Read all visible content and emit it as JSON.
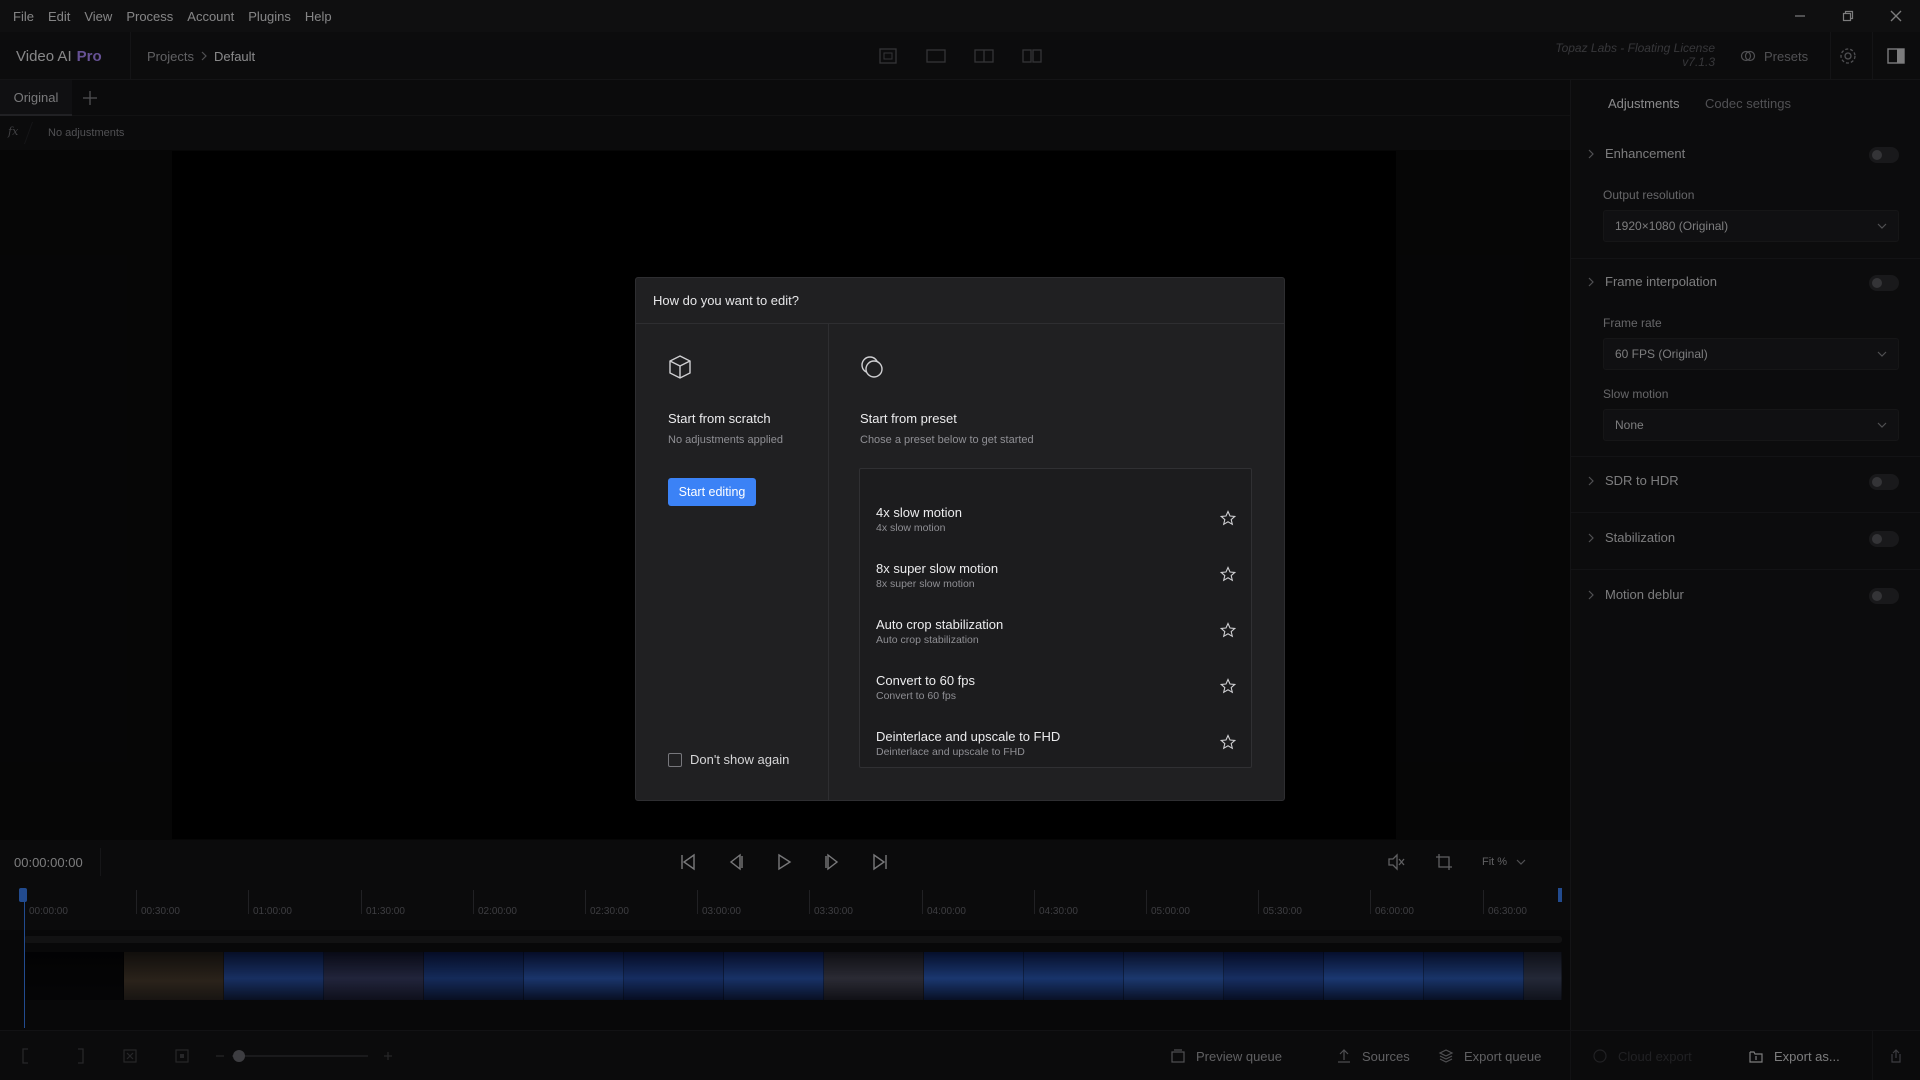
{
  "menu": [
    "File",
    "Edit",
    "View",
    "Process",
    "Account",
    "Plugins",
    "Help"
  ],
  "app": {
    "name": "Video AI",
    "edition": "Pro"
  },
  "breadcrumb": {
    "parent": "Projects",
    "current": "Default"
  },
  "license": {
    "text": "Topaz Labs - Floating License",
    "version": "v7.1.3"
  },
  "header": {
    "presets_label": "Presets"
  },
  "tabs": {
    "original": "Original"
  },
  "adjustments_bar": {
    "label": "No adjustments"
  },
  "dialog": {
    "title": "How do you want to edit?",
    "scratch": {
      "title": "Start from scratch",
      "subtitle": "No adjustments applied",
      "button": "Start editing"
    },
    "preset": {
      "title": "Start from preset",
      "subtitle": "Chose a preset below to get started"
    },
    "presets": [
      {
        "name": "4x slow motion",
        "desc": "4x slow motion"
      },
      {
        "name": "8x super slow motion",
        "desc": "8x super slow motion"
      },
      {
        "name": "Auto crop stabilization",
        "desc": "Auto crop stabilization"
      },
      {
        "name": "Convert to 60 fps",
        "desc": "Convert to 60 fps"
      },
      {
        "name": "Deinterlace and upscale to FHD",
        "desc": "Deinterlace and upscale to FHD"
      }
    ],
    "dont_show_again": "Don't show again"
  },
  "transport": {
    "timecode": "00:00:00:00",
    "fit_label": "Fit %"
  },
  "ruler": {
    "labels": [
      "00:00:00",
      "00:30:00",
      "01:00:00",
      "01:30:00",
      "02:00:00",
      "02:30:00",
      "03:00:00",
      "03:30:00",
      "04:00:00",
      "04:30:00",
      "05:00:00",
      "05:30:00",
      "06:00:00",
      "06:30:00"
    ]
  },
  "bottom_bar": {
    "preview_queue": "Preview queue",
    "sources": "Sources",
    "export_queue": "Export queue",
    "cloud_export": "Cloud export",
    "export_as": "Export as..."
  },
  "right_panel": {
    "tabs": [
      "Adjustments",
      "Codec settings"
    ],
    "enhancement": "Enhancement",
    "output_resolution_label": "Output resolution",
    "output_resolution_value": "1920×1080 (Original)",
    "frame_interpolation": "Frame interpolation",
    "frame_rate_label": "Frame rate",
    "frame_rate_value": "60 FPS (Original)",
    "slow_motion_label": "Slow motion",
    "slow_motion_value": "None",
    "sdr_to_hdr": "SDR to HDR",
    "stabilization": "Stabilization",
    "motion_deblur": "Motion deblur"
  },
  "colors": {
    "accent": "#3b82f6",
    "pro": "#b08cff",
    "background": "#0f0f10"
  }
}
